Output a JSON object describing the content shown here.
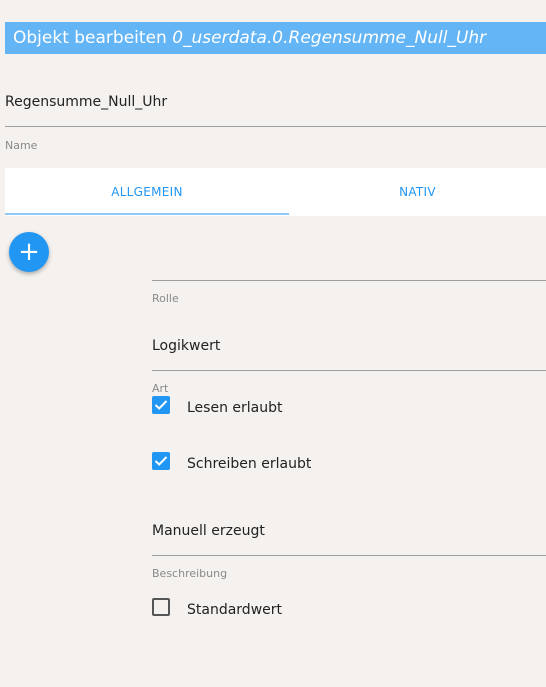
{
  "dialog": {
    "title_prefix": "Objekt bearbeiten ",
    "object_id": "0_userdata.0.Regensumme_Null_Uhr"
  },
  "name_field": {
    "value": "Regensumme_Null_Uhr",
    "label": "Name"
  },
  "tabs": [
    {
      "label": "ALLGEMEIN",
      "active": true
    },
    {
      "label": "NATIV",
      "active": false
    }
  ],
  "add_button": {
    "icon": "plus-icon",
    "symbol": "+"
  },
  "fields": {
    "role_label": "Rolle",
    "type_value": "Logikwert",
    "type_label": "Art",
    "desc_value": "Manuell erzeugt",
    "desc_label": "Beschreibung"
  },
  "checkboxes": [
    {
      "label": "Lesen erlaubt",
      "checked": true
    },
    {
      "label": "Schreiben erlaubt",
      "checked": true
    },
    {
      "label": "Standardwert",
      "checked": false
    }
  ],
  "colors": {
    "accent": "#2196f3",
    "title_bar": "#64b5f6",
    "background": "#f4f1ee"
  }
}
